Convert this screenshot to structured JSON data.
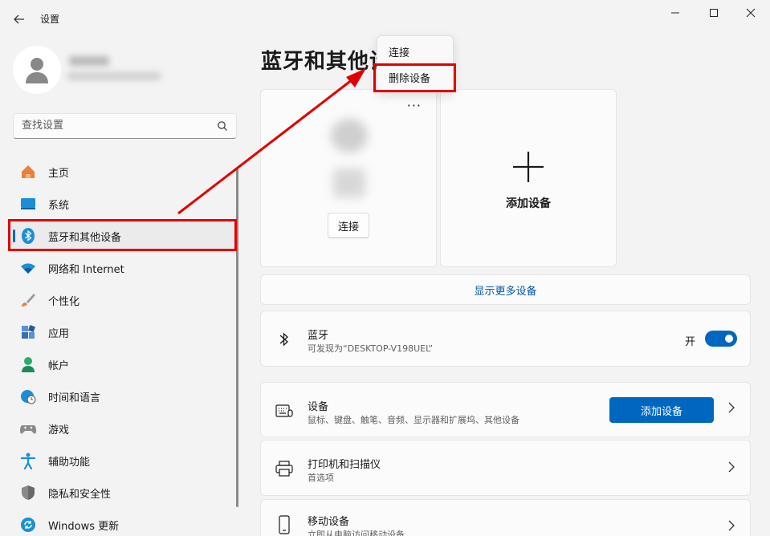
{
  "app": {
    "title": "设置"
  },
  "window_controls": {
    "minimize": "—",
    "maximize": "☐",
    "close": "✕"
  },
  "search": {
    "placeholder": "查找设置"
  },
  "sidebar": {
    "items": [
      {
        "label": "主页",
        "icon": "home-icon",
        "color": "#e8813a"
      },
      {
        "label": "系统",
        "icon": "system-icon",
        "color": "#1a8fd6"
      },
      {
        "label": "蓝牙和其他设备",
        "icon": "bluetooth-icon",
        "color": "#1a8fd6",
        "active": true
      },
      {
        "label": "网络和 Internet",
        "icon": "wifi-icon",
        "color": "#1a8fd6"
      },
      {
        "label": "个性化",
        "icon": "brush-icon",
        "color": "#e8813a"
      },
      {
        "label": "应用",
        "icon": "apps-icon",
        "color": "#3a6fb5"
      },
      {
        "label": "帐户",
        "icon": "account-icon",
        "color": "#2eaa6e"
      },
      {
        "label": "时间和语言",
        "icon": "clock-globe-icon",
        "color": "#1a8fd6"
      },
      {
        "label": "游戏",
        "icon": "gamepad-icon",
        "color": "#888888"
      },
      {
        "label": "辅助功能",
        "icon": "accessibility-icon",
        "color": "#1a8fd6"
      },
      {
        "label": "隐私和安全性",
        "icon": "shield-icon",
        "color": "#888888"
      },
      {
        "label": "Windows 更新",
        "icon": "update-icon",
        "color": "#1a8fd6"
      }
    ]
  },
  "main": {
    "title": "蓝牙和其他设",
    "device_card": {
      "more": "···",
      "connect_label": "连接"
    },
    "add_card": {
      "label": "添加设备"
    },
    "show_more": "显示更多设备",
    "bluetooth": {
      "title": "蓝牙",
      "subtitle": "可发现为“DESKTOP-V198UEL”",
      "toggle_label": "开",
      "toggle_on": true
    },
    "devices": {
      "title": "设备",
      "subtitle": "鼠标、键盘、触笔、音频、显示器和扩展坞、其他设备",
      "button": "添加设备"
    },
    "printers": {
      "title": "打印机和扫描仪",
      "subtitle": "首选项"
    },
    "mobile": {
      "title": "移动设备",
      "subtitle": "立即从电脑访问移动设备"
    }
  },
  "context_menu": {
    "items": [
      "连接",
      "删除设备"
    ]
  },
  "annotation_color": "#e00000",
  "accent_color": "#0067c0"
}
